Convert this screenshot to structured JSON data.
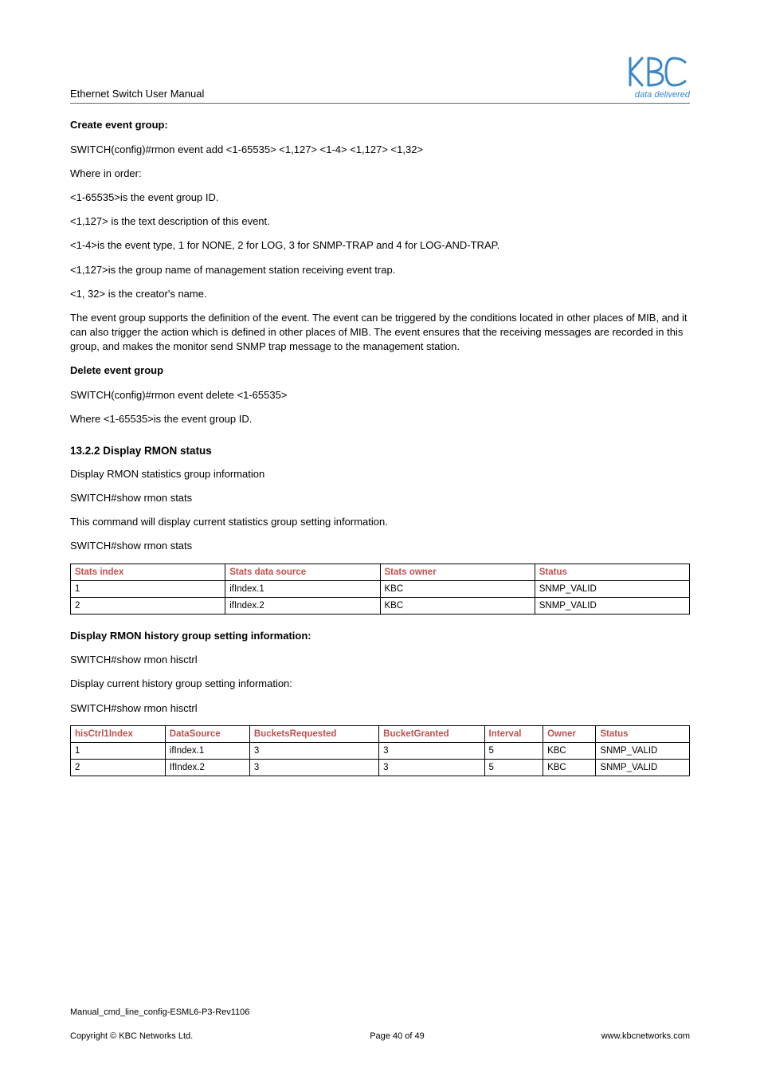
{
  "header": {
    "title": "Ethernet Switch User Manual",
    "tagline": "data delivered"
  },
  "s1": {
    "h": "Create event group:",
    "p1": "SWITCH(config)#rmon event add <1-65535> <1,127> <1-4> <1,127> <1,32>",
    "p2": "Where in order:",
    "p3": "<1-65535>is the event group ID.",
    "p4": "<1,127> is the text description of this event.",
    "p5": "<1-4>is the event type, 1 for NONE, 2 for LOG, 3 for SNMP-TRAP and 4 for LOG-AND-TRAP.",
    "p6": "<1,127>is the group name of management station receiving event trap.",
    "p7": "<1, 32> is the creator's name.",
    "p8": "The event group supports the definition of the event. The event can be triggered by the conditions located in other places of MIB, and it can also trigger the action which is defined in other places of MIB. The event ensures that the receiving messages are recorded in this group, and makes the monitor send SNMP trap message to the management station."
  },
  "s2": {
    "h": "Delete event group",
    "p1": "SWITCH(config)#rmon event delete <1-65535>",
    "p2": "Where  <1-65535>is the event group ID."
  },
  "s3": {
    "h": "13.2.2 Display RMON status",
    "p1": "Display RMON statistics group information",
    "p2": "SWITCH#show rmon stats",
    "p3": "This command will display current statistics group setting information.",
    "p4": "SWITCH#show rmon stats"
  },
  "table1": {
    "headers": [
      "Stats index",
      "Stats data source",
      "Stats owner",
      "Status"
    ],
    "rows": [
      [
        "1",
        "ifIndex.1",
        "KBC",
        "SNMP_VALID"
      ],
      [
        "2",
        "ifIndex.2",
        "KBC",
        "SNMP_VALID"
      ]
    ]
  },
  "s4": {
    "h": "Display RMON history group setting information:",
    "p1": "SWITCH#show rmon hisctrl",
    "p2": "Display current history group setting information:",
    "p3": "SWITCH#show rmon hisctrl"
  },
  "table2": {
    "headers": [
      "hisCtrl1Index",
      "DataSource",
      "BucketsRequested",
      "BucketGranted",
      "Interval",
      "Owner",
      "Status"
    ],
    "rows": [
      [
        "1",
        "ifIndex.1",
        "3",
        "3",
        "5",
        "KBC",
        "SNMP_VALID"
      ],
      [
        "2",
        "IfIndex.2",
        "3",
        "3",
        "5",
        "KBC",
        "SNMP_VALID"
      ]
    ]
  },
  "footer": {
    "line1": "Manual_cmd_line_config-ESML6-P3-Rev1106",
    "copyright": "Copyright © KBC Networks Ltd.",
    "page": "Page 40 of 49",
    "url": "www.kbcnetworks.com"
  }
}
